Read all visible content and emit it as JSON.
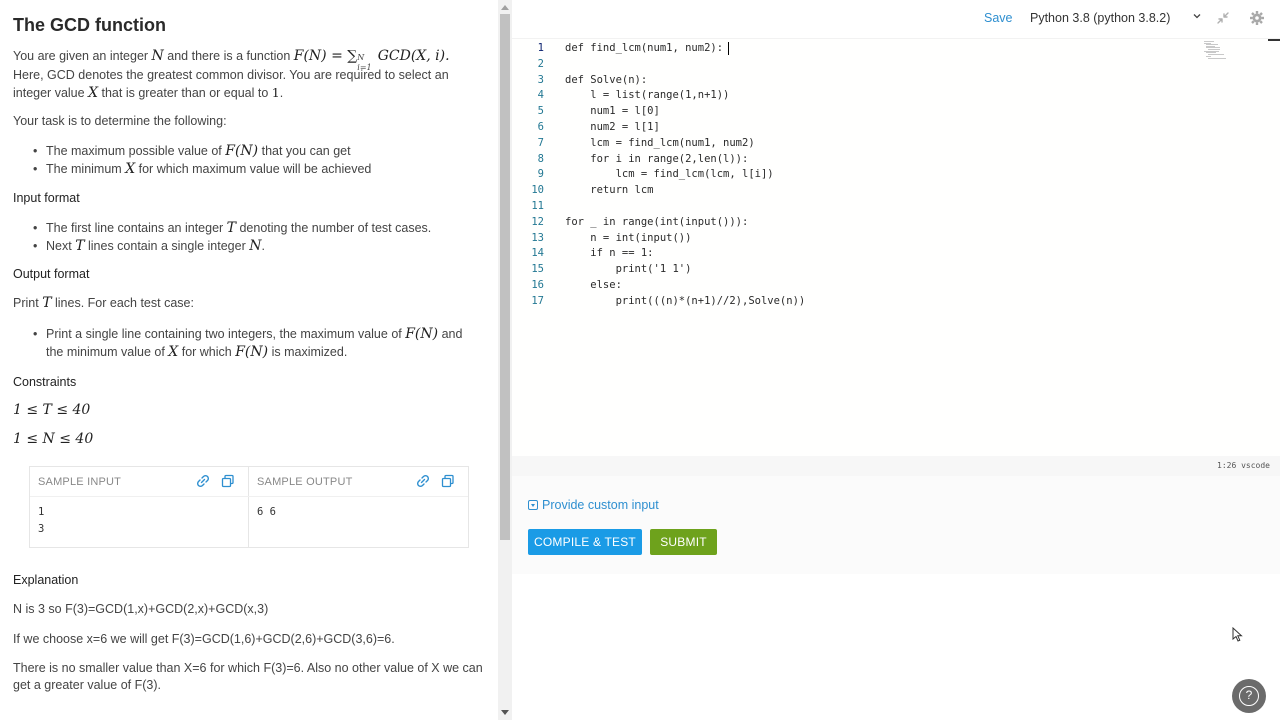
{
  "problem": {
    "title": "The GCD function",
    "intro_line1_a": "You are given an integer ",
    "intro_N": "N",
    "intro_line1_b": " and there is a function ",
    "intro_formula": "F(N) = ∑",
    "intro_sum_upper": "N",
    "intro_sum_lower": "i=1",
    "intro_formula_tail": " GCD(X, i).",
    "intro_line2": "Here, GCD denotes the greatest common divisor. You are required to select an",
    "intro_line3_a": "integer value ",
    "intro_X": "X",
    "intro_line3_b": " that is greater than or equal to ",
    "intro_one": "1",
    "intro_line3_c": ".",
    "task": "Your task is to determine the following:",
    "task_items": [
      {
        "a": "The maximum possible value of ",
        "math": "F(N)",
        "b": " that you can get"
      },
      {
        "a": "The minimum ",
        "math": "X",
        "b": " for which maximum value will be achieved"
      }
    ],
    "input_heading": "Input format",
    "input_items": [
      {
        "a": "The first line contains an integer ",
        "math": "T",
        "b": " denoting the number of test cases."
      },
      {
        "a": "Next ",
        "math": "T",
        "b": " lines contain a single integer ",
        "math2": "N",
        "c": "."
      }
    ],
    "output_heading": "Output format",
    "output_intro_a": "Print ",
    "output_intro_math": "T",
    "output_intro_b": " lines. For each test case:",
    "output_item_line1_a": "Print a single line containing two integers, the maximum value of ",
    "output_item_line1_math": "F(N)",
    "output_item_line1_b": " and",
    "output_item_line2_a": "the minimum value of ",
    "output_item_line2_math": "X",
    "output_item_line2_b": " for which ",
    "output_item_line2_math2": "F(N)",
    "output_item_line2_c": " is maximized.",
    "constraints_heading": "Constraints",
    "constraint_1": "1 ≤ T ≤ 40",
    "constraint_2": "1 ≤ N ≤ 40",
    "sample_input_label": "SAMPLE INPUT",
    "sample_output_label": "SAMPLE OUTPUT",
    "sample_input_lines": [
      "1",
      "3"
    ],
    "sample_output_lines": [
      "6 6"
    ],
    "explanation_heading": "Explanation",
    "explanation_1": "N is 3 so F(3)=GCD(1,x)+GCD(2,x)+GCD(x,3)",
    "explanation_2": "If we choose x=6 we will get F(3)=GCD(1,6)+GCD(2,6)+GCD(3,6)=6.",
    "explanation_3a": "There is no smaller value than X=6 for which F(3)=6. Also no other value of X we can",
    "explanation_3b": "get a greater value of F(3)."
  },
  "toolbar": {
    "save_label": "Save",
    "language": "Python 3.8 (python 3.8.2)",
    "icons": [
      "collapse-icon",
      "gear-icon"
    ]
  },
  "editor": {
    "lines": [
      {
        "n": "1",
        "code": "def find_lcm(num1, num2):"
      },
      {
        "n": "2",
        "code": ""
      },
      {
        "n": "3",
        "code": "def Solve(n):"
      },
      {
        "n": "4",
        "code": "    l = list(range(1,n+1))"
      },
      {
        "n": "5",
        "code": "    num1 = l[0]"
      },
      {
        "n": "6",
        "code": "    num2 = l[1]"
      },
      {
        "n": "7",
        "code": "    lcm = find_lcm(num1, num2)"
      },
      {
        "n": "8",
        "code": "    for i in range(2,len(l)):"
      },
      {
        "n": "9",
        "code": "        lcm = find_lcm(lcm, l[i])"
      },
      {
        "n": "10",
        "code": "    return lcm"
      },
      {
        "n": "11",
        "code": ""
      },
      {
        "n": "12",
        "code": "for _ in range(int(input())):"
      },
      {
        "n": "13",
        "code": "    n = int(input())"
      },
      {
        "n": "14",
        "code": "    if n == 1:"
      },
      {
        "n": "15",
        "code": "        print('1 1')"
      },
      {
        "n": "16",
        "code": "    else:"
      },
      {
        "n": "17",
        "code": "        print(((n)*(n+1)//2),Solve(n))"
      }
    ],
    "status": "1:26 vscode"
  },
  "actions": {
    "custom_input": "Provide custom input",
    "compile_label": "COMPILE & TEST",
    "submit_label": "SUBMIT",
    "help_label": "?"
  },
  "colors": {
    "accent": "#2e8fd0",
    "compile": "#1a9be6",
    "submit": "#6ea21c"
  }
}
